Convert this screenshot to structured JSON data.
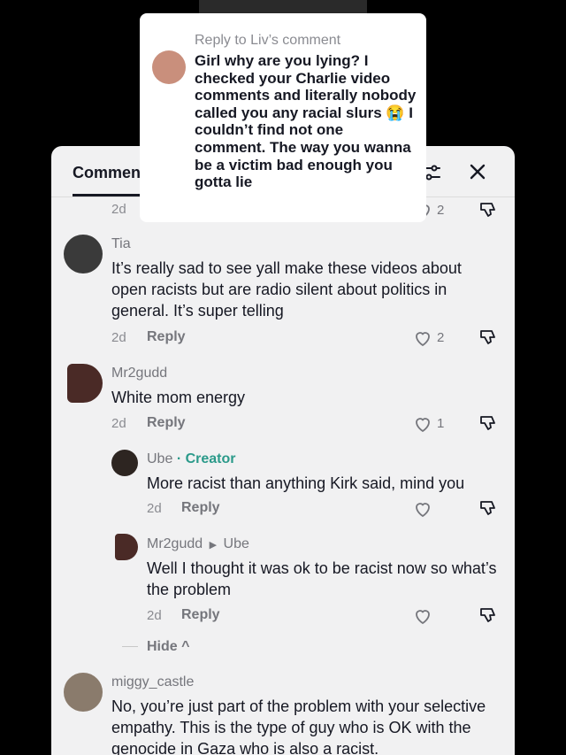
{
  "reply_card": {
    "header": "Reply to Liv’s comment",
    "text": "Girl why are you lying? I checked your Charlie video comments and literally nobody called you any racial slurs 😭 I couldn’t find not one comment. The way you wanna be a victim bad enough you gotta lie"
  },
  "panel": {
    "title": "Comments",
    "reply_label": "Reply",
    "hide_label": "Hide ^"
  },
  "top_partial": {
    "time": "2d",
    "likes": "2"
  },
  "comments": [
    {
      "username": "Tia",
      "text": "It’s really sad to see yall make these videos about open racists but are radio silent about politics in general. It’s super telling",
      "time": "2d",
      "likes": "2"
    },
    {
      "username": "Mr2gudd",
      "text": "White mom energy",
      "time": "2d",
      "likes": "1"
    }
  ],
  "replies": [
    {
      "username": "Ube",
      "badge": "· Creator",
      "text": "More racist than anything Kirk said, mind you",
      "time": "2d"
    },
    {
      "username": "Mr2gudd",
      "reply_to": "Ube",
      "text": "Well I thought it was ok to be racist now so what’s the problem",
      "time": "2d"
    }
  ],
  "last_comment": {
    "username": "miggy_castle",
    "text": "No, you’re just part of the problem with your selective empathy. This is the type of guy who is OK with the genocide in Gaza who is also a racist."
  }
}
